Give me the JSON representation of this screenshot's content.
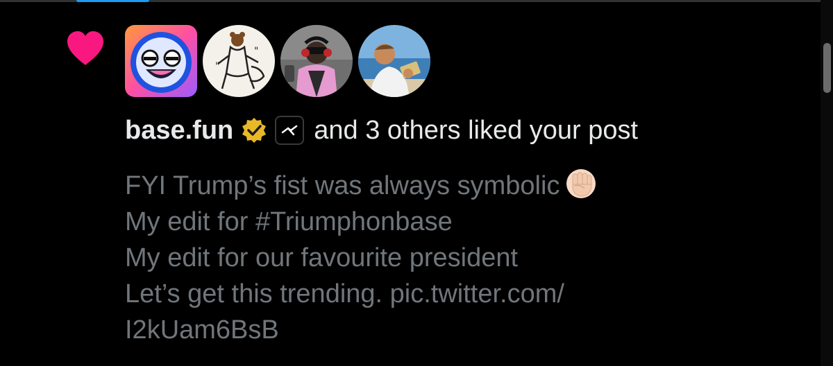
{
  "colors": {
    "background": "#000000",
    "heart": "#f91880",
    "primary_text": "#e7e9ea",
    "secondary_text": "#71767b",
    "verified_gold": "#e8b829"
  },
  "notification": {
    "icon": "heart-icon",
    "avatars": [
      {
        "name": "base-fun-avatar"
      },
      {
        "name": "bear-sketch-avatar"
      },
      {
        "name": "pink-hoodie-avatar"
      },
      {
        "name": "beach-man-avatar"
      }
    ],
    "user_name": "base.fun",
    "verified_badge": "verified-badge-icon",
    "app_icon": "app-logo-icon",
    "action_text": "and 3 others liked your post"
  },
  "post": {
    "lines": [
      "FYI Trump’s fist was always symbolic",
      "My edit for #Triumphonbase",
      "My edit for our favourite president",
      "Let’s get this trending. pic.twitter.com/",
      "I2kUam6BsB"
    ],
    "emoji": "raised-fist-emoji"
  }
}
